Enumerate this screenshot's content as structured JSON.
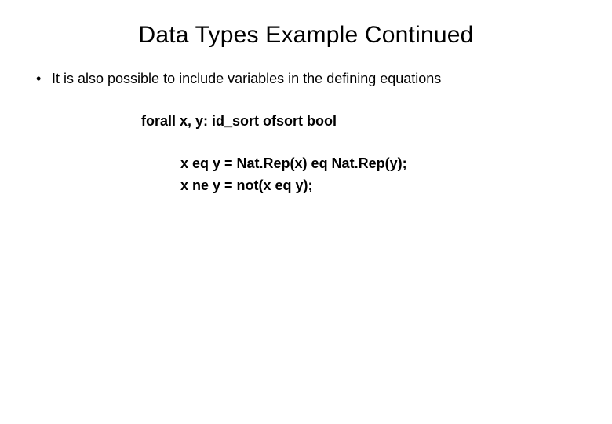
{
  "title": "Data Types Example Continued",
  "bullet": "It is also possible to include variables in the defining equations",
  "forall": "forall  x, y: id_sort   ofsort  bool",
  "equations": {
    "eq1": "x eq y = Nat.Rep(x) eq Nat.Rep(y);",
    "eq2": "x ne y = not(x eq y);"
  }
}
